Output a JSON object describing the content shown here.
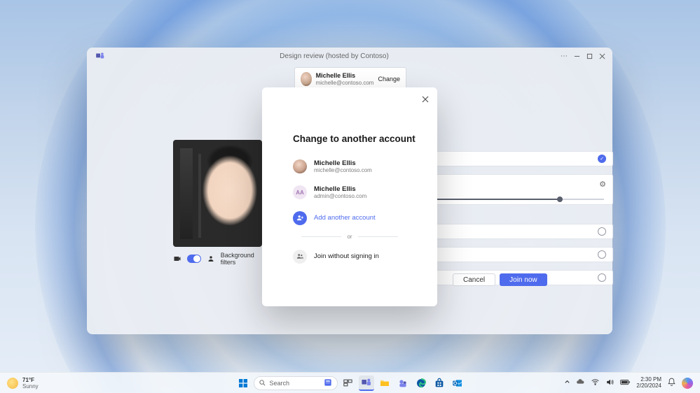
{
  "window": {
    "title": "Design review (hosted by Contoso)"
  },
  "account_chip": {
    "name": "Michelle Ellis",
    "email": "michelle@contoso.com",
    "change_label": "Change"
  },
  "preview": {
    "bg_filters_label": "Background filters"
  },
  "actions": {
    "cancel": "Cancel",
    "join": "Join now"
  },
  "modal": {
    "title": "Change to another account",
    "accounts": [
      {
        "name": "Michelle Ellis",
        "email": "michelle@contoso.com",
        "avatar": "photo"
      },
      {
        "name": "Michelle Ellis",
        "email": "admin@contoso.com",
        "avatar": "AA"
      }
    ],
    "add_label": "Add another account",
    "or_label": "or",
    "guest_label": "Join without signing in"
  },
  "taskbar": {
    "weather_temp": "71°F",
    "weather_cond": "Sunny",
    "search_placeholder": "Search",
    "time": "2:30 PM",
    "date": "2/20/2024"
  }
}
